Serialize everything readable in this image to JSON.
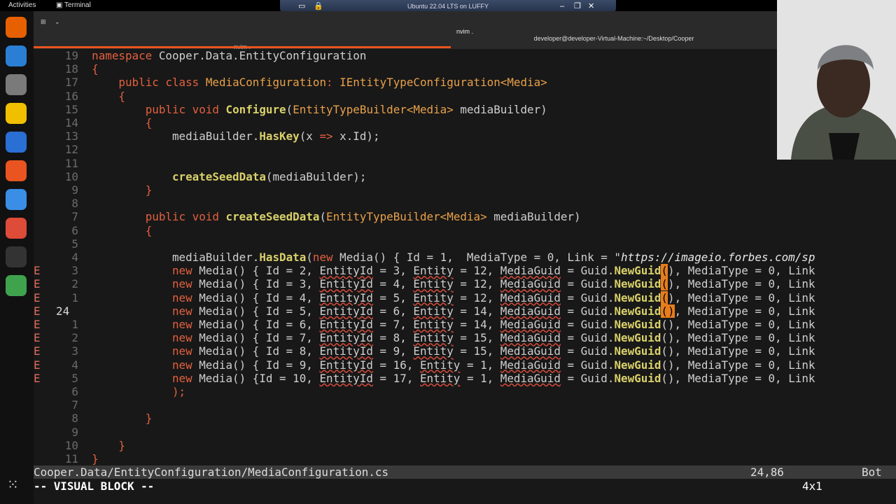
{
  "topbar": {
    "activities": "Activities",
    "app": "Terminal"
  },
  "vm_title": "Ubuntu 22.04 LTS on LUFFY",
  "terminal": {
    "window_title": "nvim .",
    "tab1_label": "nvim .",
    "tab2_label": "developer@developer-Virtual-Machine:~/Desktop/Cooper"
  },
  "editor": {
    "lines": [
      {
        "num": "19",
        "sign": "",
        "segs": [
          {
            "c": "kw",
            "t": "namespace"
          },
          {
            "c": "",
            "t": " Cooper.Data.EntityConfiguration"
          }
        ]
      },
      {
        "num": "18",
        "sign": "",
        "segs": [
          {
            "c": "kw",
            "t": "{"
          }
        ]
      },
      {
        "num": "17",
        "sign": "",
        "segs": [
          {
            "c": "",
            "t": "    "
          },
          {
            "c": "kw",
            "t": "public class"
          },
          {
            "c": "",
            "t": " "
          },
          {
            "c": "ty",
            "t": "MediaConfiguration"
          },
          {
            "c": "kw",
            "t": ": "
          },
          {
            "c": "ty",
            "t": "IEntityTypeConfiguration<Media>"
          }
        ]
      },
      {
        "num": "16",
        "sign": "",
        "segs": [
          {
            "c": "",
            "t": "    "
          },
          {
            "c": "kw",
            "t": "{"
          }
        ]
      },
      {
        "num": "15",
        "sign": "",
        "segs": [
          {
            "c": "",
            "t": "        "
          },
          {
            "c": "kw",
            "t": "public void"
          },
          {
            "c": "",
            "t": " "
          },
          {
            "c": "fn",
            "t": "Configure"
          },
          {
            "c": "",
            "t": "("
          },
          {
            "c": "ty",
            "t": "EntityTypeBuilder<Media>"
          },
          {
            "c": "",
            "t": " mediaBuilder)"
          }
        ]
      },
      {
        "num": "14",
        "sign": "",
        "segs": [
          {
            "c": "",
            "t": "        "
          },
          {
            "c": "kw",
            "t": "{"
          }
        ]
      },
      {
        "num": "13",
        "sign": "",
        "segs": [
          {
            "c": "",
            "t": "            mediaBuilder."
          },
          {
            "c": "fn",
            "t": "HasKey"
          },
          {
            "c": "",
            "t": "(x "
          },
          {
            "c": "kw",
            "t": "=>"
          },
          {
            "c": "",
            "t": " x.Id);"
          }
        ]
      },
      {
        "num": "12",
        "sign": "",
        "segs": []
      },
      {
        "num": "11",
        "sign": "",
        "segs": []
      },
      {
        "num": "10",
        "sign": "",
        "segs": [
          {
            "c": "",
            "t": "            "
          },
          {
            "c": "fn",
            "t": "createSeedData"
          },
          {
            "c": "",
            "t": "(mediaBuilder);"
          }
        ]
      },
      {
        "num": "9",
        "sign": "",
        "segs": [
          {
            "c": "",
            "t": "        "
          },
          {
            "c": "kw",
            "t": "}"
          }
        ]
      },
      {
        "num": "8",
        "sign": "",
        "segs": []
      },
      {
        "num": "7",
        "sign": "",
        "segs": [
          {
            "c": "",
            "t": "        "
          },
          {
            "c": "kw",
            "t": "public void"
          },
          {
            "c": "",
            "t": " "
          },
          {
            "c": "fn",
            "t": "createSeedData"
          },
          {
            "c": "",
            "t": "("
          },
          {
            "c": "ty",
            "t": "EntityTypeBuilder<Media>"
          },
          {
            "c": "",
            "t": " mediaBuilder)"
          }
        ]
      },
      {
        "num": "6",
        "sign": "",
        "segs": [
          {
            "c": "",
            "t": "        "
          },
          {
            "c": "kw",
            "t": "{"
          }
        ]
      },
      {
        "num": "5",
        "sign": "",
        "segs": []
      },
      {
        "num": "4",
        "sign": "",
        "segs": [
          {
            "c": "",
            "t": "            mediaBuilder."
          },
          {
            "c": "fn",
            "t": "HasData"
          },
          {
            "c": "",
            "t": "("
          },
          {
            "c": "kw",
            "t": "new"
          },
          {
            "c": "",
            "t": " Media() { Id = 1,  MediaType = 0, Link = \""
          },
          {
            "c": "str",
            "t": "https://imageio.forbes.com/sp"
          }
        ]
      },
      {
        "num": "3",
        "sign": "E",
        "segs": [
          {
            "c": "",
            "t": "            "
          },
          {
            "c": "kw",
            "t": "new"
          },
          {
            "c": "",
            "t": " Media() { Id = 2, "
          },
          {
            "c": "err",
            "t": "EntityId"
          },
          {
            "c": "",
            "t": " = 3, "
          },
          {
            "c": "err",
            "t": "Entity"
          },
          {
            "c": "",
            "t": " = 12, "
          },
          {
            "c": "err",
            "t": "MediaGuid"
          },
          {
            "c": "",
            "t": " = Guid."
          },
          {
            "c": "fn",
            "t": "NewGuid"
          },
          {
            "c": "sel",
            "t": "("
          },
          {
            "c": "",
            "t": "), MediaType = 0, Link"
          }
        ]
      },
      {
        "num": "2",
        "sign": "E",
        "segs": [
          {
            "c": "",
            "t": "            "
          },
          {
            "c": "kw",
            "t": "new"
          },
          {
            "c": "",
            "t": " Media() { Id = 3, "
          },
          {
            "c": "err",
            "t": "EntityId"
          },
          {
            "c": "",
            "t": " = 4, "
          },
          {
            "c": "err",
            "t": "Entity"
          },
          {
            "c": "",
            "t": " = 12, "
          },
          {
            "c": "err",
            "t": "MediaGuid"
          },
          {
            "c": "",
            "t": " = Guid."
          },
          {
            "c": "fn",
            "t": "NewGuid"
          },
          {
            "c": "sel",
            "t": "("
          },
          {
            "c": "",
            "t": "), MediaType = 0, Link"
          }
        ]
      },
      {
        "num": "1",
        "sign": "E",
        "segs": [
          {
            "c": "",
            "t": "            "
          },
          {
            "c": "kw",
            "t": "new"
          },
          {
            "c": "",
            "t": " Media() { Id = 4, "
          },
          {
            "c": "err",
            "t": "EntityId"
          },
          {
            "c": "",
            "t": " = 5, "
          },
          {
            "c": "err",
            "t": "Entity"
          },
          {
            "c": "",
            "t": " = 12, "
          },
          {
            "c": "err",
            "t": "MediaGuid"
          },
          {
            "c": "",
            "t": " = Guid."
          },
          {
            "c": "fn",
            "t": "NewGuid"
          },
          {
            "c": "sel",
            "t": "("
          },
          {
            "c": "",
            "t": "), MediaType = 0, Link"
          }
        ]
      },
      {
        "num": "24",
        "sign": "E",
        "cur": true,
        "segs": [
          {
            "c": "",
            "t": "            "
          },
          {
            "c": "kw",
            "t": "new"
          },
          {
            "c": "",
            "t": " Media() { Id = 5, "
          },
          {
            "c": "err",
            "t": "EntityId"
          },
          {
            "c": "",
            "t": " = 6, "
          },
          {
            "c": "err",
            "t": "Entity"
          },
          {
            "c": "",
            "t": " = 14, "
          },
          {
            "c": "err",
            "t": "MediaGuid"
          },
          {
            "c": "",
            "t": " = Guid."
          },
          {
            "c": "fn",
            "t": "NewGuid"
          },
          {
            "c": "sel",
            "t": "()"
          },
          {
            "c": "",
            "t": ", MediaType = 0, Link"
          }
        ]
      },
      {
        "num": "1",
        "sign": "E",
        "segs": [
          {
            "c": "",
            "t": "            "
          },
          {
            "c": "kw",
            "t": "new"
          },
          {
            "c": "",
            "t": " Media() { Id = 6, "
          },
          {
            "c": "err",
            "t": "EntityId"
          },
          {
            "c": "",
            "t": " = 7, "
          },
          {
            "c": "err",
            "t": "Entity"
          },
          {
            "c": "",
            "t": " = 14, "
          },
          {
            "c": "err",
            "t": "MediaGuid"
          },
          {
            "c": "",
            "t": " = Guid."
          },
          {
            "c": "fn",
            "t": "NewGuid"
          },
          {
            "c": "",
            "t": "(), MediaType = 0, Link"
          }
        ]
      },
      {
        "num": "2",
        "sign": "E",
        "segs": [
          {
            "c": "",
            "t": "            "
          },
          {
            "c": "kw",
            "t": "new"
          },
          {
            "c": "",
            "t": " Media() { Id = 7, "
          },
          {
            "c": "err",
            "t": "EntityId"
          },
          {
            "c": "",
            "t": " = 8, "
          },
          {
            "c": "err",
            "t": "Entity"
          },
          {
            "c": "",
            "t": " = 15, "
          },
          {
            "c": "err",
            "t": "MediaGuid"
          },
          {
            "c": "",
            "t": " = Guid."
          },
          {
            "c": "fn",
            "t": "NewGuid"
          },
          {
            "c": "",
            "t": "(), MediaType = 0, Link"
          }
        ]
      },
      {
        "num": "3",
        "sign": "E",
        "segs": [
          {
            "c": "",
            "t": "            "
          },
          {
            "c": "kw",
            "t": "new"
          },
          {
            "c": "",
            "t": " Media() { Id = 8, "
          },
          {
            "c": "err",
            "t": "EntityId"
          },
          {
            "c": "",
            "t": " = 9, "
          },
          {
            "c": "err",
            "t": "Entity"
          },
          {
            "c": "",
            "t": " = 15, "
          },
          {
            "c": "err",
            "t": "MediaGuid"
          },
          {
            "c": "",
            "t": " = Guid."
          },
          {
            "c": "fn",
            "t": "NewGuid"
          },
          {
            "c": "",
            "t": "(), MediaType = 0, Link"
          }
        ]
      },
      {
        "num": "4",
        "sign": "E",
        "segs": [
          {
            "c": "",
            "t": "            "
          },
          {
            "c": "kw",
            "t": "new"
          },
          {
            "c": "",
            "t": " Media() { Id = 9, "
          },
          {
            "c": "err",
            "t": "EntityId"
          },
          {
            "c": "",
            "t": " = 16, "
          },
          {
            "c": "err",
            "t": "Entity"
          },
          {
            "c": "",
            "t": " = 1, "
          },
          {
            "c": "err",
            "t": "MediaGuid"
          },
          {
            "c": "",
            "t": " = Guid."
          },
          {
            "c": "fn",
            "t": "NewGuid"
          },
          {
            "c": "",
            "t": "(), MediaType = 0, Link"
          }
        ]
      },
      {
        "num": "5",
        "sign": "E",
        "segs": [
          {
            "c": "",
            "t": "            "
          },
          {
            "c": "kw",
            "t": "new"
          },
          {
            "c": "",
            "t": " Media() {Id = 10, "
          },
          {
            "c": "err",
            "t": "EntityId"
          },
          {
            "c": "",
            "t": " = 17, "
          },
          {
            "c": "err",
            "t": "Entity"
          },
          {
            "c": "",
            "t": " = 1, "
          },
          {
            "c": "err",
            "t": "MediaGuid"
          },
          {
            "c": "",
            "t": " = Guid."
          },
          {
            "c": "fn",
            "t": "NewGuid"
          },
          {
            "c": "",
            "t": "(), MediaType = 0, Link"
          }
        ]
      },
      {
        "num": "6",
        "sign": "",
        "segs": [
          {
            "c": "",
            "t": "            "
          },
          {
            "c": "kw",
            "t": ");"
          }
        ]
      },
      {
        "num": "7",
        "sign": "",
        "segs": []
      },
      {
        "num": "8",
        "sign": "",
        "segs": [
          {
            "c": "",
            "t": "        "
          },
          {
            "c": "kw",
            "t": "}"
          }
        ]
      },
      {
        "num": "9",
        "sign": "",
        "segs": []
      },
      {
        "num": "10",
        "sign": "",
        "segs": [
          {
            "c": "",
            "t": "    "
          },
          {
            "c": "kw",
            "t": "}"
          }
        ]
      },
      {
        "num": "11",
        "sign": "",
        "segs": [
          {
            "c": "kw",
            "t": "}"
          }
        ]
      }
    ]
  },
  "statusline": {
    "file": "Cooper.Data/EntityConfiguration/MediaConfiguration.cs",
    "position": "24,86",
    "percent": "Bot"
  },
  "cmdline": {
    "mode": "-- VISUAL BLOCK --",
    "selection_size": "4x1"
  },
  "dock": {
    "icons": [
      {
        "name": "firefox-icon",
        "color": "#e66000"
      },
      {
        "name": "thunderbird-icon",
        "color": "#2a7fd4"
      },
      {
        "name": "files-icon",
        "color": "#7a7a7a"
      },
      {
        "name": "rhythmbox-icon",
        "color": "#f0c000"
      },
      {
        "name": "writer-icon",
        "color": "#2a6fd4"
      },
      {
        "name": "software-icon",
        "color": "#e95420"
      },
      {
        "name": "help-icon",
        "color": "#3a8ee6"
      },
      {
        "name": "chrome-icon",
        "color": "#dd4b39"
      },
      {
        "name": "terminal-icon",
        "color": "#333333"
      },
      {
        "name": "trash-icon",
        "color": "#3fa34d"
      }
    ],
    "apps_icon": "apps-grid-icon"
  }
}
